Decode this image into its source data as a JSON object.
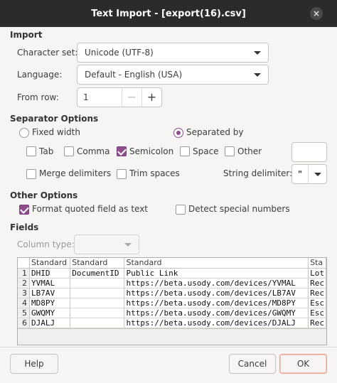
{
  "window": {
    "title": "Text Import - [export(16).csv]",
    "close_glyph": "×"
  },
  "import": {
    "heading": "Import",
    "charset_label": "Character set:",
    "charset_value": "Unicode (UTF-8)",
    "language_label": "Language:",
    "language_value": "Default - English (USA)",
    "from_row_label": "From row:",
    "from_row_value": "1",
    "minus": "−",
    "plus": "+"
  },
  "separator": {
    "heading": "Separator Options",
    "fixed_width": "Fixed width",
    "separated_by": "Separated by",
    "tab": "Tab",
    "comma": "Comma",
    "semicolon": "Semicolon",
    "space": "Space",
    "other": "Other",
    "merge": "Merge delimiters",
    "trim": "Trim spaces",
    "string_delim_label": "String delimiter:",
    "string_delim_value": "\""
  },
  "other_options": {
    "heading": "Other Options",
    "quoted_as_text": "Format quoted field as text",
    "detect_special": "Detect special numbers"
  },
  "fields": {
    "heading": "Fields",
    "column_type_label": "Column type:",
    "headers": [
      "Standard",
      "Standard",
      "Standard",
      "Sta"
    ],
    "rows": [
      {
        "n": "1",
        "c": [
          "DHID",
          "DocumentID",
          "Public Link",
          "Lot"
        ]
      },
      {
        "n": "2",
        "c": [
          "YVMAL",
          "",
          "https://beta.usody.com/devices/YVMAL",
          "Rec"
        ]
      },
      {
        "n": "3",
        "c": [
          "LB7AV",
          "",
          "https://beta.usody.com/devices/LB7AV",
          "Rec"
        ]
      },
      {
        "n": "4",
        "c": [
          "MD8PY",
          "",
          "https://beta.usody.com/devices/MD8PY",
          "Esc"
        ]
      },
      {
        "n": "5",
        "c": [
          "GWQMY",
          "",
          "https://beta.usody.com/devices/GWQMY",
          "Esc"
        ]
      },
      {
        "n": "6",
        "c": [
          "DJALJ",
          "",
          "https://beta.usody.com/devices/DJALJ",
          "Rec"
        ]
      }
    ]
  },
  "buttons": {
    "help": "Help",
    "cancel": "Cancel",
    "ok": "OK"
  },
  "colors": {
    "accent": "#8c4f8c",
    "titlebar": "#2b2b2b",
    "ok_border": "#e9a08c"
  },
  "checked": {
    "semicolon": true,
    "separated_by": true,
    "quoted_as_text": true
  }
}
